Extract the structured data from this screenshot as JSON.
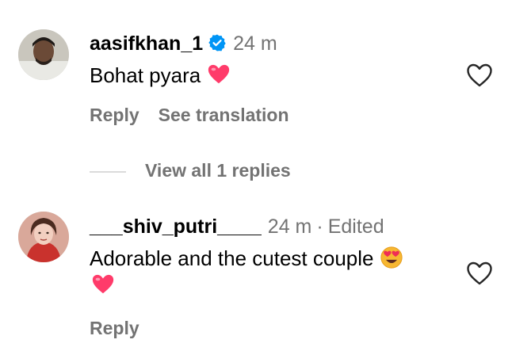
{
  "comments": [
    {
      "username": "aasifkhan_1",
      "verified": true,
      "time": "24 m",
      "text": "Bohat pyara",
      "reply_label": "Reply",
      "translate_label": "See translation"
    },
    {
      "username": "___shiv_putri____",
      "time": "24 m",
      "dot": "·",
      "edited": "Edited",
      "text": "Adorable and the cutest couple",
      "reply_label": "Reply"
    }
  ],
  "view_replies_label": "View all 1 replies",
  "colors": {
    "secondary_text": "#737373",
    "verified_blue": "#0095f6",
    "heart_pink": "#ff3b6a",
    "divider": "#dbdbdb"
  }
}
